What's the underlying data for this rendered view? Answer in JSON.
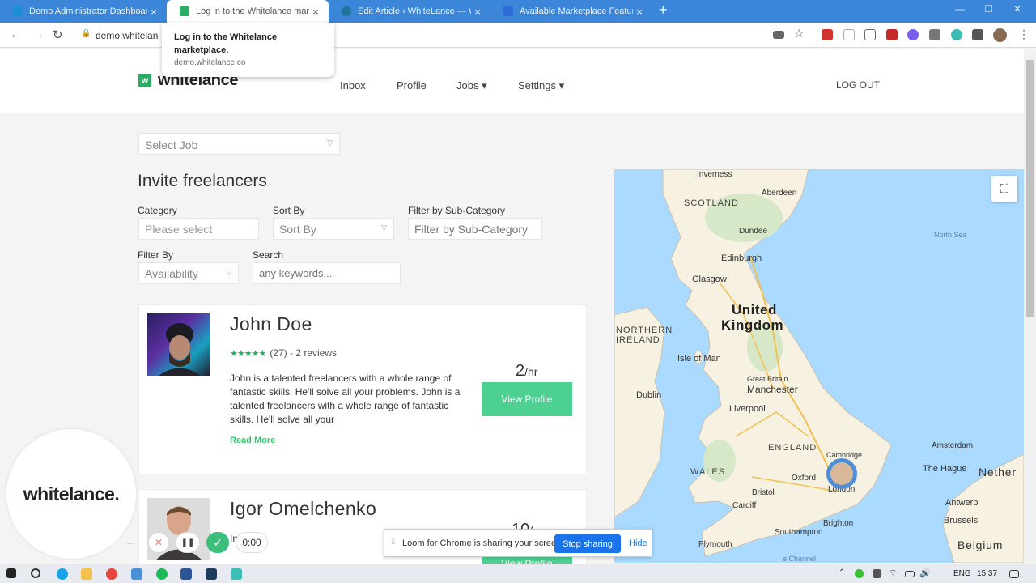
{
  "browser": {
    "tabs": [
      {
        "title": "Demo Administrator Dashboard",
        "favicon_color": "#1d8fd6"
      },
      {
        "title": "Log in to the Whitelance market",
        "favicon_color": "#27ae60"
      },
      {
        "title": "Edit Article ‹ WhiteLance — Wor",
        "favicon_color": "#21759b"
      },
      {
        "title": "Available Marketplace Features",
        "favicon_color": "#2d6bd8"
      }
    ],
    "close_glyph": "×",
    "new_tab_glyph": "+",
    "url": "demo.whitelan",
    "tooltip_title": "Log in to the Whitelance marketplace.",
    "tooltip_url": "demo.whitelance.co"
  },
  "site": {
    "logo_mark": "W",
    "logo_text": "whitelance",
    "nav": [
      "Inbox",
      "Profile",
      "Jobs ▾",
      "Settings ▾"
    ],
    "logout": "LOG OUT",
    "accent_color": "#4cd190"
  },
  "filters": {
    "select_job": "Select Job",
    "heading": "Invite freelancers",
    "category_label": "Category",
    "category_value": "Please select",
    "sortby_label": "Sort By",
    "sortby_value": "Sort By",
    "subcat_label": "Filter by Sub-Category",
    "subcat_placeholder": "Filter by Sub-Category",
    "filterby_label": "Filter By",
    "filterby_value": "Availability",
    "search_label": "Search",
    "search_placeholder": "any keywords..."
  },
  "freelancers": [
    {
      "name": "John Doe",
      "stars": "★★★★★",
      "rating_text": "(27) - 2 reviews",
      "description": "John is a talented freelancers with a whole range of fantastic skills. He'll solve all your problems. John is a talented freelancers with a whole range of fantastic skills. He'll solve all your",
      "read_more": "Read More",
      "rate": "2",
      "rate_unit": "/hr",
      "button": "View Profile"
    },
    {
      "name": "Igor Omelchenko",
      "description": "In   tion",
      "rate": "10",
      "rate_unit": "/",
      "button": "View Profile"
    }
  ],
  "map": {
    "labels": {
      "inverness": "Inverness",
      "aberdeen": "Aberdeen",
      "scotland": "SCOTLAND",
      "dundee": "Dundee",
      "north_sea": "North Sea",
      "edinburgh": "Edinburgh",
      "glasgow": "Glasgow",
      "uk1": "United",
      "uk2": "Kingdom",
      "ni1": "NORTHERN",
      "ni2": "IRELAND",
      "isle_of_man": "Isle of Man",
      "dublin": "Dublin",
      "great_britain": "Great Britain",
      "manchester": "Manchester",
      "liverpool": "Liverpool",
      "england": "ENGLAND",
      "cambridge": "Cambridge",
      "amsterdam": "Amsterdam",
      "the_hague": "The Hague",
      "nether": "Nether",
      "wales": "WALES",
      "oxford": "Oxford",
      "london": "London",
      "bristol": "Bristol",
      "cardiff": "Cardiff",
      "antwerp": "Antwerp",
      "brussels": "Brussels",
      "southampton": "Southampton",
      "brighton": "Brighton",
      "belgium": "Belgium",
      "plymouth": "Plymouth",
      "channel": "e Channel"
    },
    "fullscreen_icon": "⛶"
  },
  "loom": {
    "bubble_text": "whitelance.",
    "more": "···",
    "cancel": "✕",
    "pause": "❚❚",
    "done": "✓",
    "timer": "0:00",
    "share_text": "Loom for Chrome is sharing your screen.",
    "stop": "Stop sharing",
    "hide": "Hide"
  },
  "taskbar": {
    "lang": "ENG",
    "time": "15:37"
  }
}
